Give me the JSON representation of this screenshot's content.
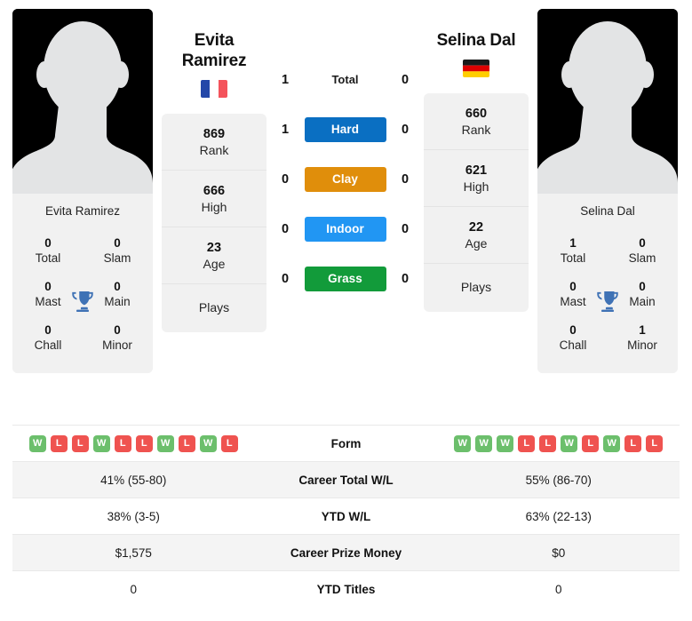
{
  "players": {
    "left": {
      "name_lines": [
        "Evita",
        "Ramirez"
      ],
      "name_full": "Evita Ramirez",
      "flag": "france-flag",
      "flag_name": "France",
      "rank": "869",
      "rank_label": "Rank",
      "high": "666",
      "high_label": "High",
      "age": "23",
      "age_label": "Age",
      "plays_label": "Plays",
      "plays_value": "",
      "titles": {
        "total": "0",
        "total_label": "Total",
        "slam": "0",
        "slam_label": "Slam",
        "mast": "0",
        "mast_label": "Mast",
        "main": "0",
        "main_label": "Main",
        "chall": "0",
        "chall_label": "Chall",
        "minor": "0",
        "minor_label": "Minor"
      },
      "form": [
        "W",
        "L",
        "L",
        "W",
        "L",
        "L",
        "W",
        "L",
        "W",
        "L"
      ],
      "career_wl": "41% (55-80)",
      "ytd_wl": "38% (3-5)",
      "prize_money": "$1,575",
      "ytd_titles": "0"
    },
    "right": {
      "name_lines": [
        "Selina Dal"
      ],
      "name_full": "Selina Dal",
      "flag": "germany-flag",
      "flag_name": "Germany",
      "rank": "660",
      "rank_label": "Rank",
      "high": "621",
      "high_label": "High",
      "age": "22",
      "age_label": "Age",
      "plays_label": "Plays",
      "plays_value": "",
      "titles": {
        "total": "1",
        "total_label": "Total",
        "slam": "0",
        "slam_label": "Slam",
        "mast": "0",
        "mast_label": "Mast",
        "main": "0",
        "main_label": "Main",
        "chall": "0",
        "chall_label": "Chall",
        "minor": "1",
        "minor_label": "Minor"
      },
      "form": [
        "W",
        "W",
        "W",
        "L",
        "L",
        "W",
        "L",
        "W",
        "L",
        "L"
      ],
      "career_wl": "55% (86-70)",
      "ytd_wl": "63% (22-13)",
      "prize_money": "$0",
      "ytd_titles": "0"
    }
  },
  "head_to_head": [
    {
      "label": "Total",
      "left": "1",
      "right": "0",
      "style": "plain",
      "color": ""
    },
    {
      "label": "Hard",
      "left": "1",
      "right": "0",
      "style": "badge",
      "color": "#0a6fc2"
    },
    {
      "label": "Clay",
      "left": "0",
      "right": "0",
      "style": "badge",
      "color": "#e08e0b"
    },
    {
      "label": "Indoor",
      "left": "0",
      "right": "0",
      "style": "badge",
      "color": "#2196f3"
    },
    {
      "label": "Grass",
      "left": "0",
      "right": "0",
      "style": "badge",
      "color": "#129b3a"
    }
  ],
  "table": {
    "rows": [
      {
        "label": "Form",
        "type": "form",
        "left": "",
        "right": ""
      },
      {
        "label": "Career Total W/L",
        "type": "text",
        "left": "41% (55-80)",
        "right": "55% (86-70)"
      },
      {
        "label": "YTD W/L",
        "type": "text",
        "left": "38% (3-5)",
        "right": "63% (22-13)"
      },
      {
        "label": "Career Prize Money",
        "type": "text",
        "left": "$1,575",
        "right": "$0"
      },
      {
        "label": "YTD Titles",
        "type": "text",
        "left": "0",
        "right": "0"
      }
    ]
  },
  "colors": {
    "win": "#6cbf6c",
    "loss": "#ef5350",
    "hard": "#0a6fc2",
    "clay": "#e08e0b",
    "indoor": "#2196f3",
    "grass": "#129b3a",
    "trophy": "#3f72b5",
    "card_bg": "#f1f1f1"
  }
}
